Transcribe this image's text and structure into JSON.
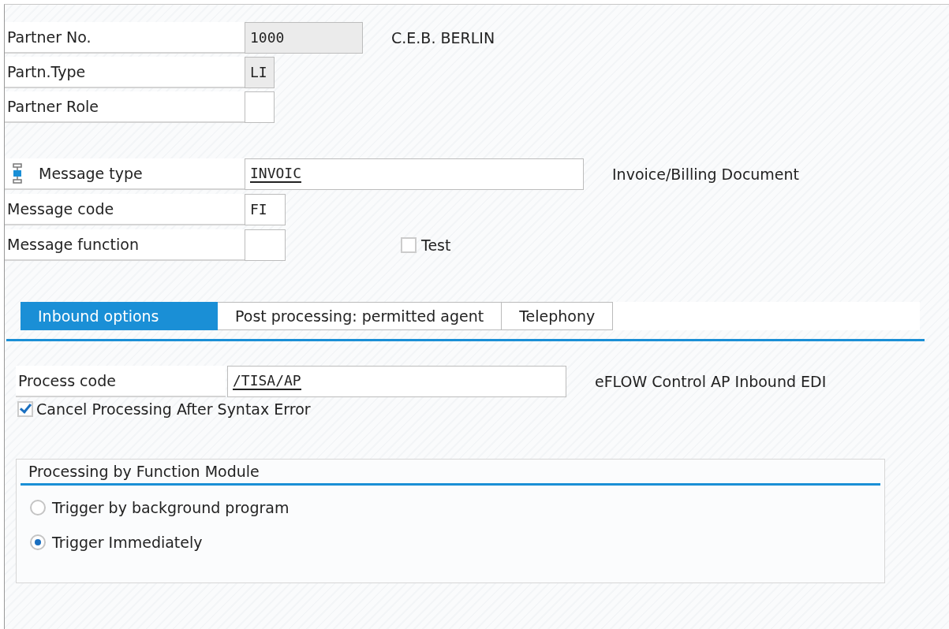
{
  "partner_fields": [
    {
      "kind": "plain",
      "label": "Partner No.",
      "value": "1000",
      "editable": false,
      "underlined": false,
      "description": "C.E.B. BERLIN"
    },
    {
      "kind": "plain",
      "label": "Partn.Type",
      "value": "LI",
      "editable": false,
      "underlined": false
    },
    {
      "kind": "plain",
      "label": "Partner Role",
      "editable": true
    }
  ],
  "message_fields": [
    {
      "kind": "icon",
      "label": "Message type",
      "value": "INVOIC",
      "editable": true,
      "underlined": true,
      "description": "Invoice/Billing Document"
    },
    {
      "kind": "plain",
      "label": "Message code",
      "value": "FI",
      "editable": true,
      "underlined": false
    },
    {
      "kind": "plain",
      "label": "Message function",
      "editable": true,
      "checkbox": {
        "label": "Test",
        "checked": false
      }
    }
  ],
  "tabs": [
    {
      "label": "Inbound options",
      "selected": true
    },
    {
      "label": "Post processing: permitted agent",
      "selected": false
    },
    {
      "label": "Telephony",
      "selected": false
    }
  ],
  "process_code": {
    "label": "Process code",
    "value": "/TISA/AP",
    "underlined": true,
    "description": "eFLOW Control AP Inbound EDI"
  },
  "cancel_checkbox": {
    "label": "Cancel Processing After Syntax Error",
    "checked": true
  },
  "group": {
    "title": "Processing by Function Module",
    "options": [
      {
        "label": "Trigger by background program",
        "selected": false
      },
      {
        "label": "Trigger Immediately",
        "selected": true
      }
    ]
  }
}
